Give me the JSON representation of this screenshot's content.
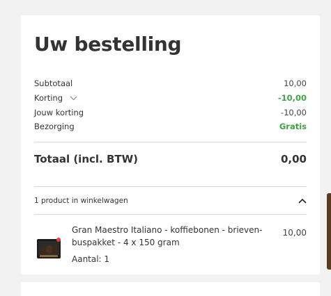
{
  "order": {
    "title": "Uw bestelling",
    "rows": [
      {
        "label": "Subtotaal",
        "value": "10,00"
      },
      {
        "label": "Korting",
        "value": "-10,00"
      },
      {
        "label": "Jouw korting",
        "value": "-10,00"
      },
      {
        "label": "Bezorging",
        "value": "Gratis"
      }
    ],
    "total_label": "Totaal (incl. BTW)",
    "total_value": "0,00",
    "cart_summary": "1 product in winkelwagen",
    "product": {
      "name": "Gran Maestro Italiano - koffiebonen - brieven-buspakket - 4 x 150 gram",
      "qty": "Aantal: 1",
      "price": "10,00"
    }
  },
  "colors": {
    "accent_green": "#3ea63e"
  },
  "icons": {
    "korting_toggle": "chevron-down-icon",
    "cart_toggle": "chevron-up-icon"
  }
}
